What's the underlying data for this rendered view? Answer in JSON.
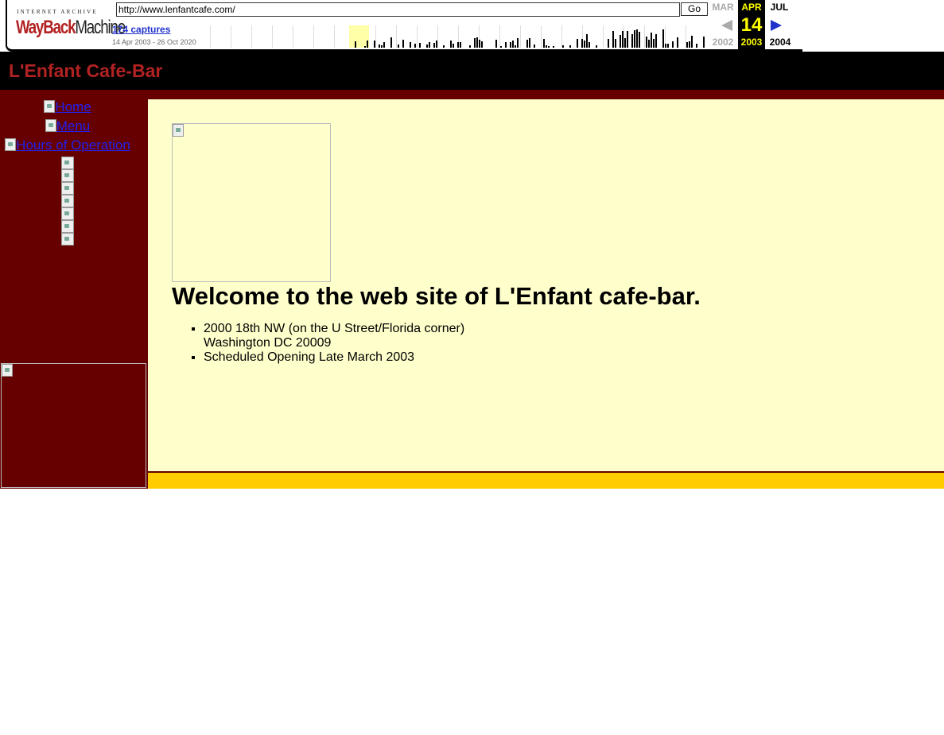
{
  "wayback": {
    "logo_top": "INTERNET ARCHIVE",
    "logo_wayback": "WayBack",
    "logo_machine": "Machine",
    "url": "http://www.lenfantcafe.com/",
    "go_label": "Go",
    "captures": "174 captures",
    "date_range": "14 Apr 2003 - 26 Oct 2020",
    "prev_month": "MAR",
    "cur_month": "APR",
    "next_month": "JUL",
    "cur_day": "14",
    "prev_year": "2002",
    "cur_year": "2003",
    "next_year": "2004"
  },
  "site": {
    "title": "L'Enfant Cafe-Bar",
    "nav": [
      "Home",
      "Menu",
      "Hours of Operation"
    ],
    "welcome": "Welcome to the web site of L'Enfant cafe-bar.",
    "address_line1": "2000 18th NW (on the U Street/Florida corner)",
    "address_line2": "Washington DC 20009",
    "opening": "Scheduled Opening Late March 2003"
  },
  "colors": {
    "maroon": "#660000",
    "cream": "#ffffcc",
    "gold": "#ffcc00",
    "title_red": "#b22222"
  }
}
